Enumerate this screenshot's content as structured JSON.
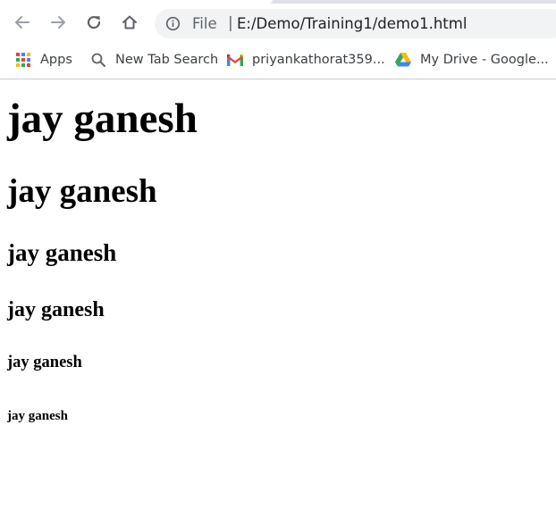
{
  "browser": {
    "omnibox": {
      "scheme": "File",
      "separator": "|",
      "url": "E:/Demo/Training1/demo1.html"
    },
    "bookmarks": [
      {
        "label": "Apps",
        "icon": "apps-grid-icon"
      },
      {
        "label": "New Tab Search",
        "icon": "search-icon"
      },
      {
        "label": "priyankathorat359...",
        "icon": "gmail-icon"
      },
      {
        "label": "My Drive - Google...",
        "icon": "google-drive-icon"
      }
    ]
  },
  "page": {
    "headings": [
      "jay ganesh",
      "jay ganesh",
      "jay ganesh",
      "jay ganesh",
      "jay ganesh",
      "jay ganesh"
    ]
  },
  "colors": {
    "chrome_bg": "#ffffff",
    "omnibox_bg": "#f1f3f4",
    "icon_gray": "#5f6368",
    "text": "#000000"
  }
}
